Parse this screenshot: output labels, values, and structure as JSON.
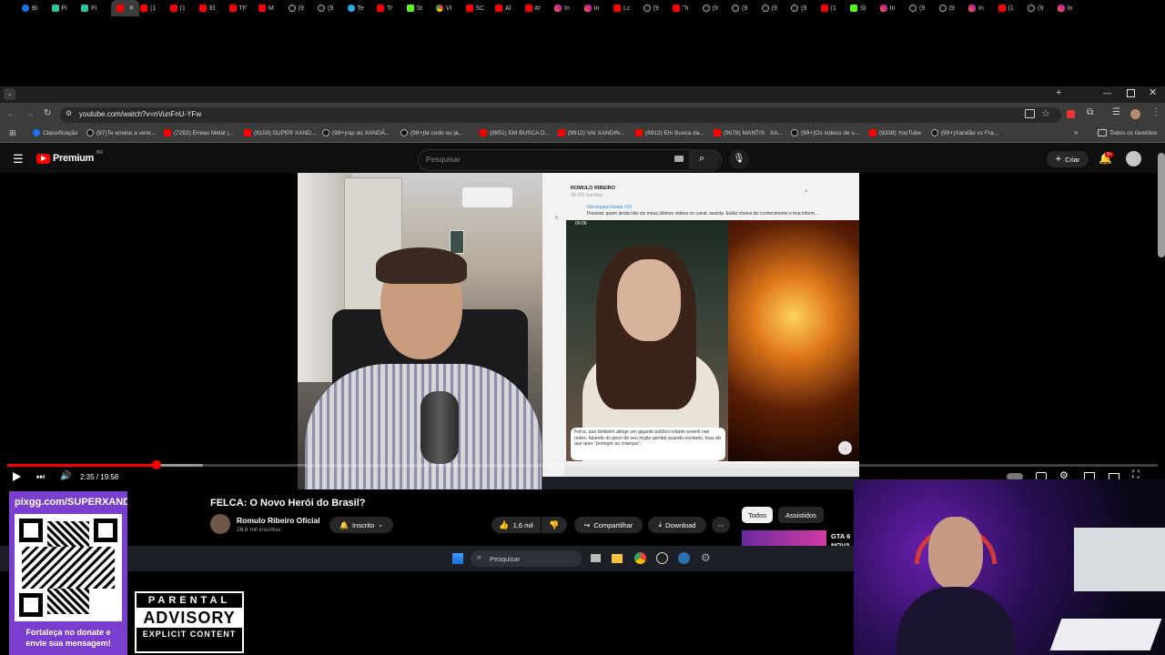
{
  "browser": {
    "tabs": [
      {
        "label": "Bi",
        "icon": "gc"
      },
      {
        "label": "Pi",
        "icon": "gn"
      },
      {
        "label": "Pi",
        "icon": "gn"
      },
      {
        "label": "",
        "icon": "yt",
        "active": true
      },
      {
        "label": "(1",
        "icon": "yt"
      },
      {
        "label": "(1",
        "icon": "yt"
      },
      {
        "label": "El",
        "icon": "yt"
      },
      {
        "label": "TF",
        "icon": "yt"
      },
      {
        "label": "M",
        "icon": "yt"
      },
      {
        "label": "(9",
        "icon": "tt"
      },
      {
        "label": "(9",
        "icon": "tt"
      },
      {
        "label": "Te",
        "icon": "tg"
      },
      {
        "label": "Tr",
        "icon": "yt"
      },
      {
        "label": "St",
        "icon": "kk"
      },
      {
        "label": "VI",
        "icon": "ch"
      },
      {
        "label": "SC",
        "icon": "yt"
      },
      {
        "label": "Al",
        "icon": "yt"
      },
      {
        "label": "#r",
        "icon": "yt"
      },
      {
        "label": "In",
        "icon": "ig"
      },
      {
        "label": "In",
        "icon": "ig"
      },
      {
        "label": "Lc",
        "icon": "yt"
      },
      {
        "label": "(9",
        "icon": "tt"
      },
      {
        "label": "\"h",
        "icon": "yt"
      },
      {
        "label": "(9",
        "icon": "tt"
      },
      {
        "label": "(9",
        "icon": "tt"
      },
      {
        "label": "(9",
        "icon": "tt"
      },
      {
        "label": "(9",
        "icon": "tt"
      },
      {
        "label": "(1",
        "icon": "yt"
      },
      {
        "label": "St",
        "icon": "kk"
      },
      {
        "label": "In",
        "icon": "ig"
      },
      {
        "label": "(9",
        "icon": "tt"
      },
      {
        "label": "(9",
        "icon": "tt"
      },
      {
        "label": "In",
        "icon": "ig"
      },
      {
        "label": "(1",
        "icon": "yt"
      },
      {
        "label": "(9",
        "icon": "tt"
      },
      {
        "label": "In",
        "icon": "ig"
      }
    ],
    "new_tab": "+",
    "url": "youtube.com/watch?v=nVunFnU-YFw",
    "bookmarks": [
      {
        "label": "Classificação",
        "icon": "gc"
      },
      {
        "label": "(97)Te ensino a venc...",
        "icon": "tt"
      },
      {
        "label": "(7292) Enéas Metal |...",
        "icon": "yt"
      },
      {
        "label": "(8159) SUPER XAND...",
        "icon": "yt"
      },
      {
        "label": "(99+)rap do XANDÃ...",
        "icon": "tt"
      },
      {
        "label": "(99+)tá cedo ou já...",
        "icon": "tt"
      },
      {
        "label": "(8851) EM BUSCA D...",
        "icon": "yt"
      },
      {
        "label": "(8912) VAI XANDIN...",
        "icon": "yt"
      },
      {
        "label": "(8912) Em Busca da...",
        "icon": "yt"
      },
      {
        "label": "(9078) MANTIS · XA...",
        "icon": "yt"
      },
      {
        "label": "(99+)Os vídeos de c...",
        "icon": "tt"
      },
      {
        "label": "(9338) YouTube",
        "icon": "yt"
      },
      {
        "label": "(99+)Xandão vs Fra...",
        "icon": "tt"
      }
    ],
    "all_bookmarks": "Todos os favoritos"
  },
  "youtube": {
    "logo": "Premium",
    "logo_badge": "BR",
    "search_placeholder": "Pesquisar",
    "create_label": "Criar",
    "notif_count": "9+",
    "time": "2:35 / 19:58",
    "progress": 0.13,
    "buffered": 0.17,
    "video_title": "FELCA: O Novo Herói do Brasil?",
    "channel_name": "Romulo Ribeiro Oficial",
    "subscribers": "26,6 mil inscritos",
    "subscribed_label": "Inscrito",
    "likes": "1,6 mil",
    "share_label": "Compartilhar",
    "download_label": "Download",
    "filter_chips": [
      "Todos",
      "Assistidos"
    ],
    "suggested_text": "GTA 6 NOVA"
  },
  "embedded": {
    "channel": "ROMULO RIBEIRO",
    "members": "26.291 inscritos",
    "pinned_title": "Mensagem fixada #23",
    "pinned_text": "Pessoal, quem ainda não viu meus últimos vídeos no canal, assista. Estão cheios de conhecimento e boa inform...",
    "video_time": "00:06",
    "bubble_text": "Felca, que também atinge um gigante público infanto-juvenil nas redes, falando do peso de seu órgão genital quando excitado, mas diz que quer \"proteger as crianças\"."
  },
  "taskbar": {
    "search_placeholder": "Pesquisar"
  },
  "overlay": {
    "donate_url": "pixgg.com/SUPERXAND/",
    "donate_text_1": "Fortaleça no donate e",
    "donate_text_2": "envie sua mensagem!",
    "advisory_1": "PARENTAL",
    "advisory_2": "ADVISORY",
    "advisory_3": "EXPLICIT CONTENT"
  }
}
